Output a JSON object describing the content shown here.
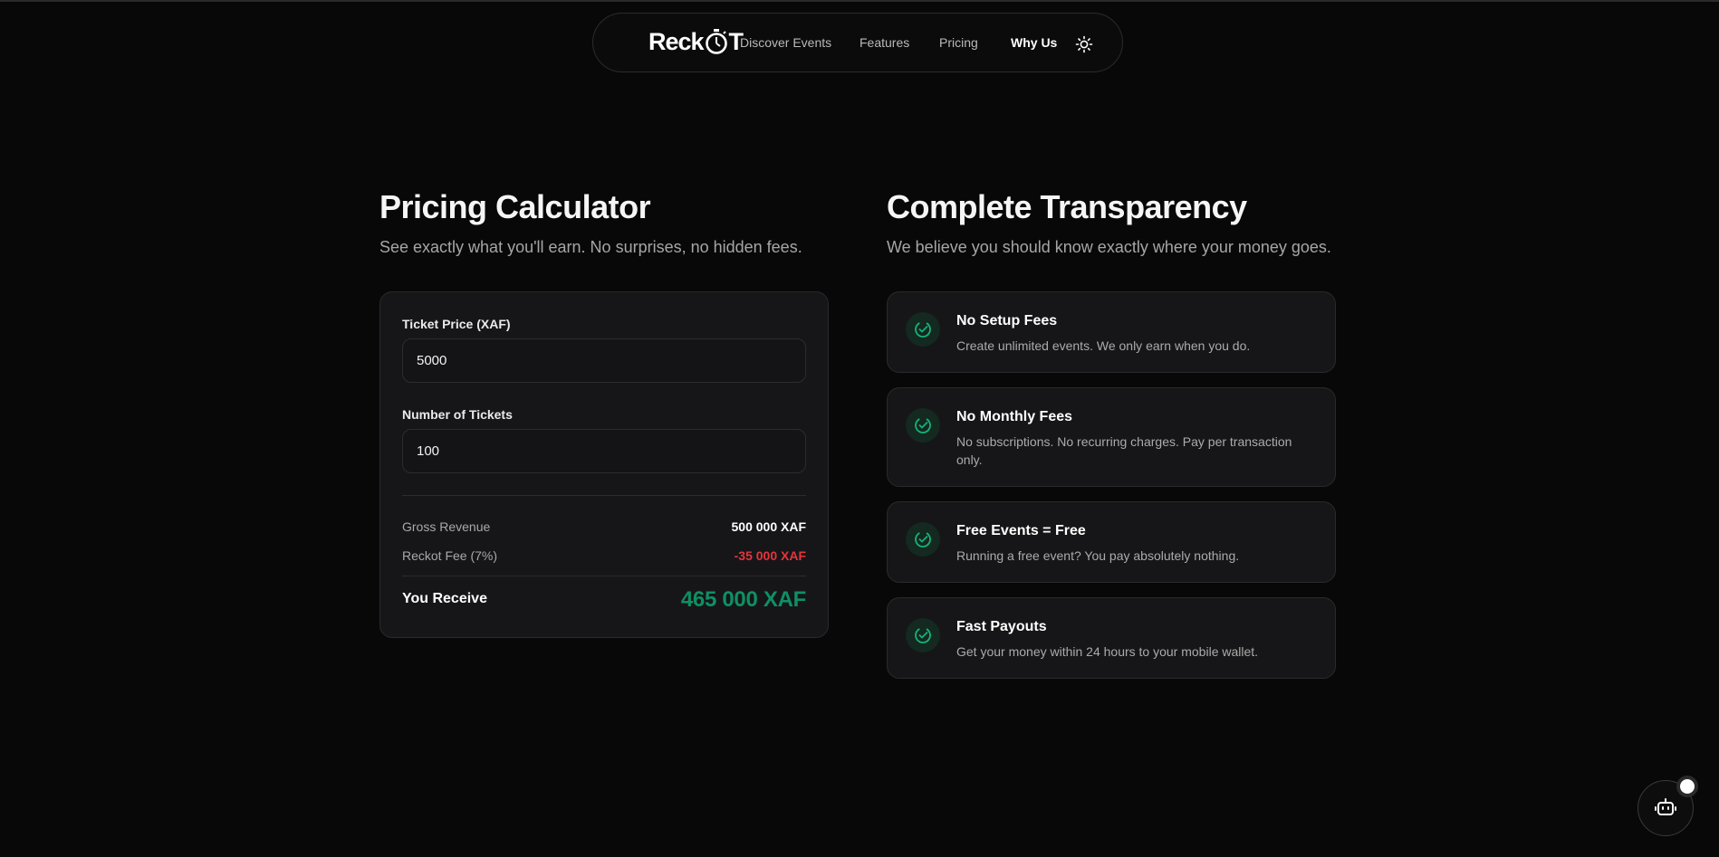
{
  "brand": {
    "logo_prefix": "Reck",
    "logo_suffix": "T"
  },
  "nav": {
    "links": [
      {
        "label": "Discover Events"
      },
      {
        "label": "Features"
      },
      {
        "label": "Pricing"
      },
      {
        "label": "Why Us"
      }
    ],
    "active": "Why Us",
    "theme_icon": "sun-icon"
  },
  "calculator": {
    "title": "Pricing Calculator",
    "subtitle": "See exactly what you'll earn. No surprises, no hidden fees.",
    "ticket_price_label": "Ticket Price (XAF)",
    "ticket_price_value": "5000",
    "tickets_label": "Number of Tickets",
    "tickets_value": "100",
    "gross_label": "Gross Revenue",
    "gross_value": "500 000 XAF",
    "fee_label": "Reckot Fee (7%)",
    "fee_value": "-35 000 XAF",
    "receive_label": "You Receive",
    "receive_value": "465 000 XAF"
  },
  "transparency": {
    "title": "Complete Transparency",
    "subtitle": "We believe you should know exactly where your money goes.",
    "items": [
      {
        "title": "No Setup Fees",
        "desc": "Create unlimited events. We only earn when you do.",
        "icon": "check-circle-icon"
      },
      {
        "title": "No Monthly Fees",
        "desc": "No subscriptions. No recurring charges. Pay per transaction only.",
        "icon": "check-circle-icon"
      },
      {
        "title": "Free Events = Free",
        "desc": "Running a free event? You pay absolutely nothing.",
        "icon": "check-circle-icon"
      },
      {
        "title": "Fast Payouts",
        "desc": "Get your money within 24 hours to your mobile wallet.",
        "icon": "check-circle-icon"
      }
    ]
  },
  "colors": {
    "accent_green": "#0f8f63",
    "fee_red": "#e5343d",
    "background": "#080808",
    "card": "#161618"
  }
}
